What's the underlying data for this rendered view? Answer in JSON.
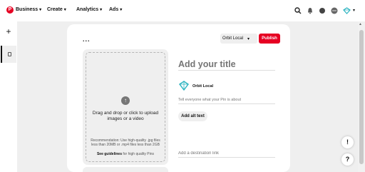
{
  "nav": {
    "business": "Business",
    "create": "Create",
    "analytics": "Analytics",
    "ads": "Ads"
  },
  "icons": {
    "search": "search-icon",
    "notifications": "bell-icon",
    "messages": "chat-icon",
    "more": "ellipsis-icon"
  },
  "rail": {
    "add": "+"
  },
  "editor": {
    "more": "...",
    "board": "Orbit Local",
    "publish": "Publish",
    "upload_main": "Drag and drop or click to upload images or a video",
    "upload_rec": "Recommendation: Use high-quality .jpg files less than 20MB or .mp4 files less than 2GB",
    "guide_bold": "See guidelines",
    "guide_rest": " for high quality Pins",
    "title_placeholder": "Add your title",
    "account_name": "Orbit Local",
    "about_placeholder": "Tell everyone what your Pin is about",
    "alt_text": "Add alt text",
    "link_placeholder": "Add a destination link"
  },
  "fabs": {
    "tips": "!",
    "help": "?"
  },
  "colors": {
    "brand": "#e60023",
    "teal": "#2bb3c0"
  }
}
